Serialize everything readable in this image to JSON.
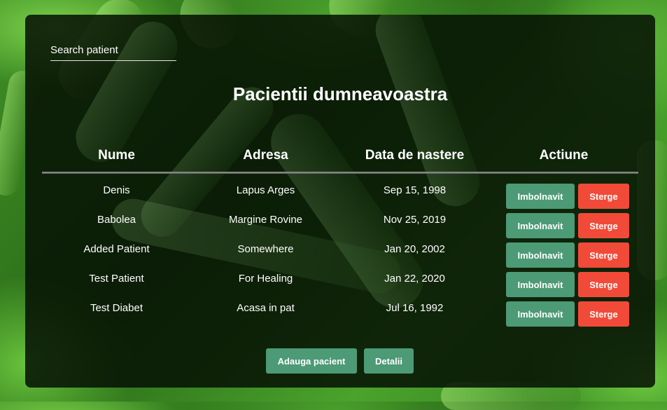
{
  "search": {
    "placeholder": "Search patient"
  },
  "title": "Pacientii dumneavoastra",
  "columns": [
    "Nume",
    "Adresa",
    "Data de nastere",
    "Actiune"
  ],
  "patients": [
    {
      "name": "Denis",
      "address": "Lapus Arges",
      "birthdate": "Sep 15, 1998"
    },
    {
      "name": "Babolea",
      "address": "Margine Rovine",
      "birthdate": "Nov 25, 2019"
    },
    {
      "name": "Added Patient",
      "address": "Somewhere",
      "birthdate": "Jan 20, 2002"
    },
    {
      "name": "Test Patient",
      "address": "For Healing",
      "birthdate": "Jan 22, 2020"
    },
    {
      "name": "Test Diabet",
      "address": "Acasa in pat",
      "birthdate": "Jul 16, 1992"
    }
  ],
  "row_actions": {
    "sick_label": "Imbolnavit",
    "delete_label": "Sterge"
  },
  "footer": {
    "add_label": "Adauga pacient",
    "details_label": "Detalii"
  },
  "colors": {
    "accent_green": "#4c9a76",
    "danger_red": "#f24a38",
    "panel_bg": "#06100"
  }
}
